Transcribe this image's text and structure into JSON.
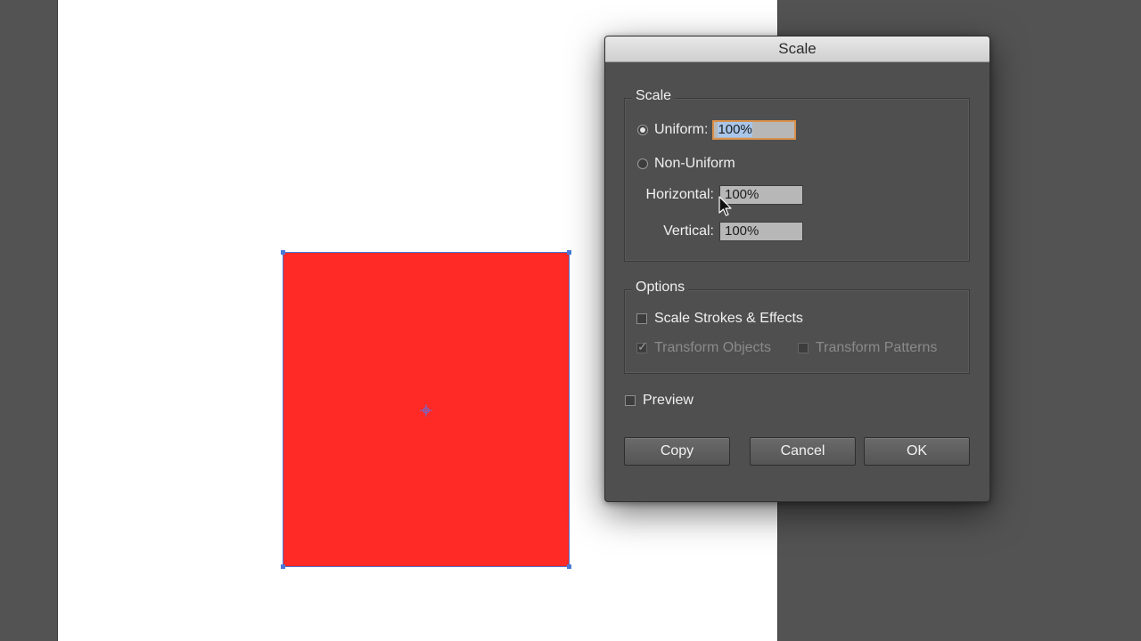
{
  "dialog": {
    "title": "Scale",
    "scale_group": {
      "label": "Scale",
      "uniform": {
        "label": "Uniform:",
        "value": "100%",
        "selected": true
      },
      "non_uniform": {
        "label": "Non-Uniform",
        "selected": false
      },
      "horizontal": {
        "label": "Horizontal:",
        "value": "100%"
      },
      "vertical": {
        "label": "Vertical:",
        "value": "100%"
      }
    },
    "options_group": {
      "label": "Options",
      "scale_strokes": {
        "label": "Scale Strokes & Effects",
        "checked": false
      },
      "transform_objects": {
        "label": "Transform Objects",
        "checked": true,
        "enabled": false
      },
      "transform_patterns": {
        "label": "Transform Patterns",
        "checked": false,
        "enabled": false
      }
    },
    "preview": {
      "label": "Preview",
      "checked": false
    },
    "buttons": {
      "copy": "Copy",
      "cancel": "Cancel",
      "ok": "OK"
    }
  },
  "canvas": {
    "shape_fill": "#ff2a25",
    "selection_color": "#4a78d6",
    "artboard_color": "#ffffff",
    "pasteboard_color": "#535353"
  }
}
